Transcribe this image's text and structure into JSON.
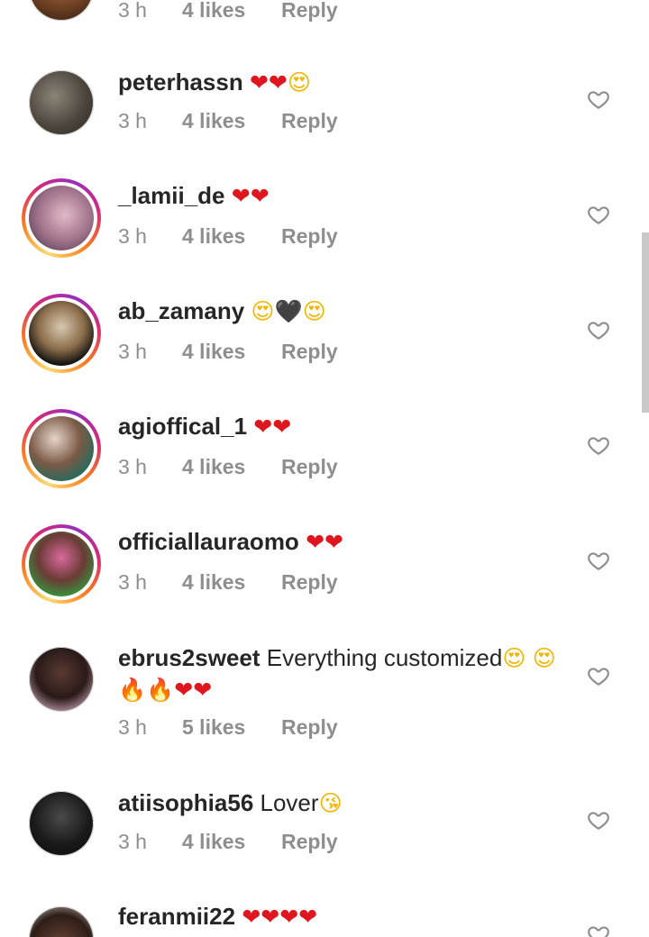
{
  "comments": [
    {
      "username": "",
      "text": "",
      "time": "3 h",
      "likes": "4 likes",
      "reply": "Reply",
      "avatar": "plain"
    },
    {
      "username": "peterhassn",
      "text": "",
      "emojis": [
        "❤",
        "❤",
        "😍"
      ],
      "time": "3 h",
      "likes": "4 likes",
      "reply": "Reply",
      "avatar": "plain"
    },
    {
      "username": "_lamii_de",
      "text": "",
      "emojis": [
        "❤",
        "❤"
      ],
      "time": "3 h",
      "likes": "4 likes",
      "reply": "Reply",
      "avatar": "story"
    },
    {
      "username": "ab_zamany",
      "text": "",
      "emojis": [
        "😍",
        "🖤",
        "😍"
      ],
      "time": "3 h",
      "likes": "4 likes",
      "reply": "Reply",
      "avatar": "story"
    },
    {
      "username": "agioffical_1",
      "text": "",
      "emojis": [
        "❤",
        "❤"
      ],
      "time": "3 h",
      "likes": "4 likes",
      "reply": "Reply",
      "avatar": "story"
    },
    {
      "username": "officiallauraomo",
      "text": "",
      "emojis": [
        "❤",
        "❤"
      ],
      "time": "3 h",
      "likes": "4 likes",
      "reply": "Reply",
      "avatar": "story"
    },
    {
      "username": "ebrus2sweet",
      "text": "Everything customized",
      "emojis": [
        "😍",
        "😍",
        "🔥",
        "🔥",
        "❤",
        "❤"
      ],
      "time": "3 h",
      "likes": "5 likes",
      "reply": "Reply",
      "avatar": "plain"
    },
    {
      "username": "atiisophia56",
      "text": "Lover",
      "emojis": [
        "😘"
      ],
      "time": "3 h",
      "likes": "4 likes",
      "reply": "Reply",
      "avatar": "plain"
    },
    {
      "username": "feranmii22",
      "text": "",
      "emojis": [
        "❤",
        "❤",
        "❤",
        "❤"
      ],
      "time": "",
      "likes": "",
      "reply": "",
      "avatar": "plain"
    }
  ],
  "icons": {
    "like": "heart-outline-icon"
  },
  "colors": {
    "meta": "#8e8e8e",
    "heart": "#e0161f",
    "story_ring": "#d62976"
  }
}
